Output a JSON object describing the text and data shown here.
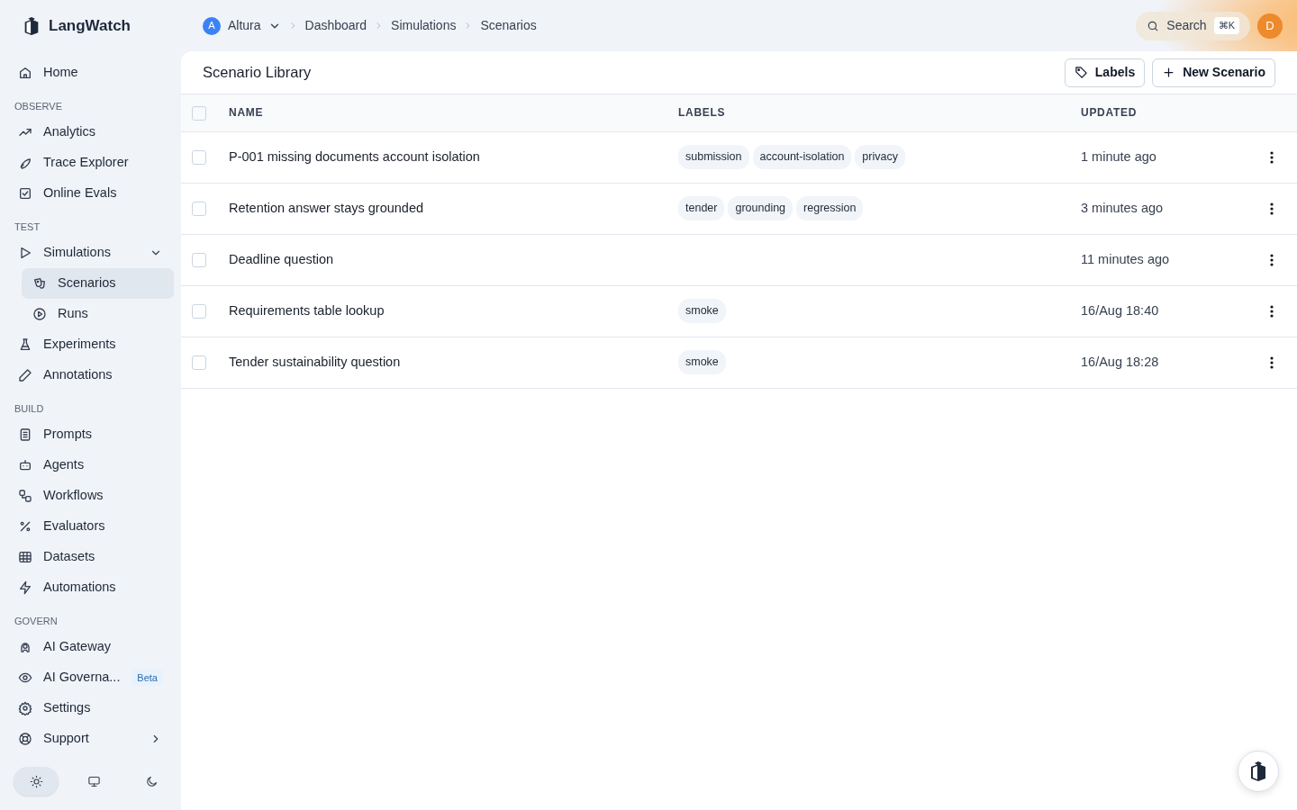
{
  "brand": {
    "name": "LangWatch"
  },
  "breadcrumb": {
    "project": {
      "avatar": "A",
      "name": "Altura"
    },
    "items": [
      "Dashboard",
      "Simulations",
      "Scenarios"
    ]
  },
  "search": {
    "label": "Search",
    "shortcut": "⌘K"
  },
  "user": {
    "avatar": "D"
  },
  "sidebar": {
    "sections": [
      {
        "items": [
          {
            "label": "Home",
            "selected": false
          }
        ]
      },
      {
        "heading": "OBSERVE",
        "items": [
          {
            "label": "Analytics",
            "selected": false
          },
          {
            "label": "Trace Explorer",
            "selected": false
          },
          {
            "label": "Online Evals",
            "selected": false
          }
        ]
      },
      {
        "heading": "TEST",
        "items": [
          {
            "label": "Simulations",
            "selected": false,
            "expanded": true,
            "children": [
              {
                "label": "Scenarios",
                "selected": true
              },
              {
                "label": "Runs",
                "selected": false
              }
            ]
          },
          {
            "label": "Experiments",
            "selected": false
          },
          {
            "label": "Annotations",
            "selected": false
          }
        ]
      },
      {
        "heading": "BUILD",
        "items": [
          {
            "label": "Prompts",
            "selected": false
          },
          {
            "label": "Agents",
            "selected": false
          },
          {
            "label": "Workflows",
            "selected": false
          },
          {
            "label": "Evaluators",
            "selected": false
          },
          {
            "label": "Datasets",
            "selected": false
          },
          {
            "label": "Automations",
            "selected": false
          }
        ]
      },
      {
        "heading": "GOVERN",
        "items": [
          {
            "label": "AI Gateway",
            "selected": false
          },
          {
            "label": "AI Governa...",
            "selected": false,
            "badge": "Beta"
          },
          {
            "label": "Settings",
            "selected": false
          },
          {
            "label": "Support",
            "selected": false,
            "expanded": false
          }
        ]
      }
    ],
    "theme": [
      {
        "kind": "light",
        "selected": true
      },
      {
        "kind": "system",
        "selected": false
      },
      {
        "kind": "dark",
        "selected": false
      }
    ]
  },
  "page": {
    "title": "Scenario Library",
    "buttons": [
      {
        "kind": "labels",
        "label": "Labels"
      },
      {
        "kind": "new",
        "label": "New Scenario"
      }
    ]
  },
  "table": {
    "all_selected": false,
    "columns": [
      "NAME",
      "LABELS",
      "UPDATED"
    ],
    "rows": [
      {
        "name": "P-001 missing documents account isolation",
        "labels": [
          "submission",
          "account-isolation",
          "privacy"
        ],
        "updated": "1 minute ago",
        "selected": false
      },
      {
        "name": "Retention answer stays grounded",
        "labels": [
          "tender",
          "grounding",
          "regression"
        ],
        "updated": "3 minutes ago",
        "selected": false
      },
      {
        "name": "Deadline question",
        "labels": [],
        "updated": "11 minutes ago",
        "selected": false
      },
      {
        "name": "Requirements table lookup",
        "labels": [
          "smoke"
        ],
        "updated": "16/Aug 18:40",
        "selected": false
      },
      {
        "name": "Tender sustainability question",
        "labels": [
          "smoke"
        ],
        "updated": "16/Aug 18:28",
        "selected": false
      }
    ]
  }
}
